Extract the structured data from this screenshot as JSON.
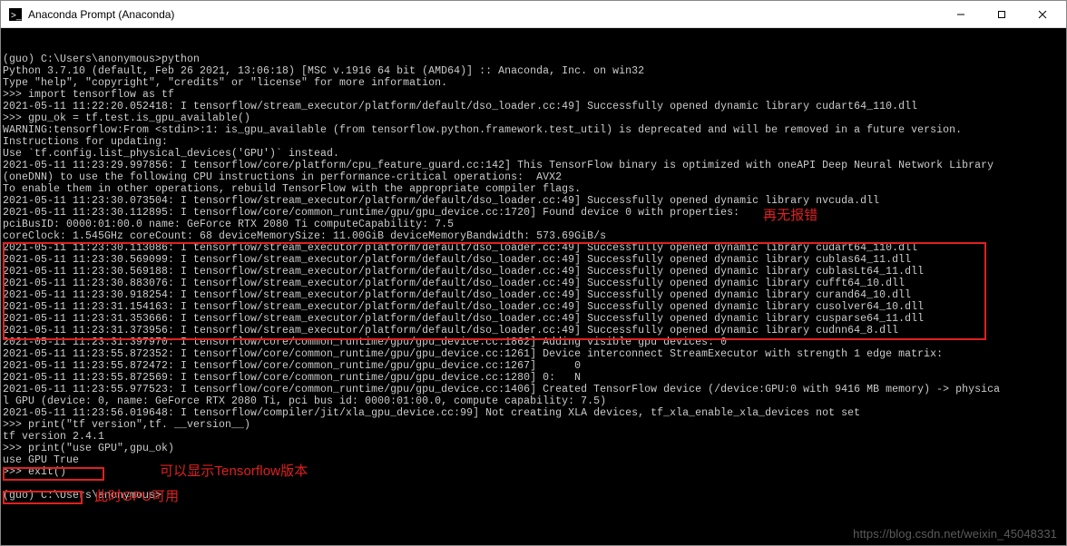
{
  "window": {
    "title": "Anaconda Prompt (Anaconda)"
  },
  "terminal_lines": [
    "(guo) C:\\Users\\anonymous>python",
    "Python 3.7.10 (default, Feb 26 2021, 13:06:18) [MSC v.1916 64 bit (AMD64)] :: Anaconda, Inc. on win32",
    "Type \"help\", \"copyright\", \"credits\" or \"license\" for more information.",
    ">>> import tensorflow as tf",
    "2021-05-11 11:22:20.052418: I tensorflow/stream_executor/platform/default/dso_loader.cc:49] Successfully opened dynamic library cudart64_110.dll",
    ">>> gpu_ok = tf.test.is_gpu_available()",
    "WARNING:tensorflow:From <stdin>:1: is_gpu_available (from tensorflow.python.framework.test_util) is deprecated and will be removed in a future version.",
    "Instructions for updating:",
    "Use `tf.config.list_physical_devices('GPU')` instead.",
    "2021-05-11 11:23:29.997856: I tensorflow/core/platform/cpu_feature_guard.cc:142] This TensorFlow binary is optimized with oneAPI Deep Neural Network Library",
    "(oneDNN) to use the following CPU instructions in performance-critical operations:  AVX2",
    "To enable them in other operations, rebuild TensorFlow with the appropriate compiler flags.",
    "2021-05-11 11:23:30.073504: I tensorflow/stream_executor/platform/default/dso_loader.cc:49] Successfully opened dynamic library nvcuda.dll",
    "2021-05-11 11:23:30.112895: I tensorflow/core/common_runtime/gpu/gpu_device.cc:1720] Found device 0 with properties:",
    "pciBusID: 0000:01:00.0 name: GeForce RTX 2080 Ti computeCapability: 7.5",
    "coreClock: 1.545GHz coreCount: 68 deviceMemorySize: 11.00GiB deviceMemoryBandwidth: 573.69GiB/s",
    "2021-05-11 11:23:30.113086: I tensorflow/stream_executor/platform/default/dso_loader.cc:49] Successfully opened dynamic library cudart64_110.dll",
    "2021-05-11 11:23:30.569099: I tensorflow/stream_executor/platform/default/dso_loader.cc:49] Successfully opened dynamic library cublas64_11.dll",
    "2021-05-11 11:23:30.569188: I tensorflow/stream_executor/platform/default/dso_loader.cc:49] Successfully opened dynamic library cublasLt64_11.dll",
    "2021-05-11 11:23:30.883076: I tensorflow/stream_executor/platform/default/dso_loader.cc:49] Successfully opened dynamic library cufft64_10.dll",
    "2021-05-11 11:23:30.918254: I tensorflow/stream_executor/platform/default/dso_loader.cc:49] Successfully opened dynamic library curand64_10.dll",
    "2021-05-11 11:23:31.154163: I tensorflow/stream_executor/platform/default/dso_loader.cc:49] Successfully opened dynamic library cusolver64_10.dll",
    "2021-05-11 11:23:31.353666: I tensorflow/stream_executor/platform/default/dso_loader.cc:49] Successfully opened dynamic library cusparse64_11.dll",
    "2021-05-11 11:23:31.373956: I tensorflow/stream_executor/platform/default/dso_loader.cc:49] Successfully opened dynamic library cudnn64_8.dll",
    "2021-05-11 11:23:31.397970: I tensorflow/core/common_runtime/gpu/gpu_device.cc:1862] Adding visible gpu devices: 0",
    "2021-05-11 11:23:55.872352: I tensorflow/core/common_runtime/gpu/gpu_device.cc:1261] Device interconnect StreamExecutor with strength 1 edge matrix:",
    "2021-05-11 11:23:55.872472: I tensorflow/core/common_runtime/gpu/gpu_device.cc:1267]      0",
    "2021-05-11 11:23:55.872569: I tensorflow/core/common_runtime/gpu/gpu_device.cc:1280] 0:   N",
    "2021-05-11 11:23:55.977523: I tensorflow/core/common_runtime/gpu/gpu_device.cc:1406] Created TensorFlow device (/device:GPU:0 with 9416 MB memory) -> physica",
    "l GPU (device: 0, name: GeForce RTX 2080 Ti, pci bus id: 0000:01:00.0, compute capability: 7.5)",
    "2021-05-11 11:23:56.019648: I tensorflow/compiler/jit/xla_gpu_device.cc:99] Not creating XLA devices, tf_xla_enable_xla_devices not set",
    ">>> print(\"tf version\",tf. __version__)",
    "tf version 2.4.1",
    ">>> print(\"use GPU\",gpu_ok)",
    "use GPU True",
    ">>> exit()",
    "",
    "(guo) C:\\Users\\anonymous>"
  ],
  "annotations": {
    "no_error": "再无报错",
    "show_version": "可以显示Tensorflow版本",
    "gpu_usable": "此时GPU可用"
  },
  "watermark": "https://blog.csdn.net/weixin_45048331"
}
